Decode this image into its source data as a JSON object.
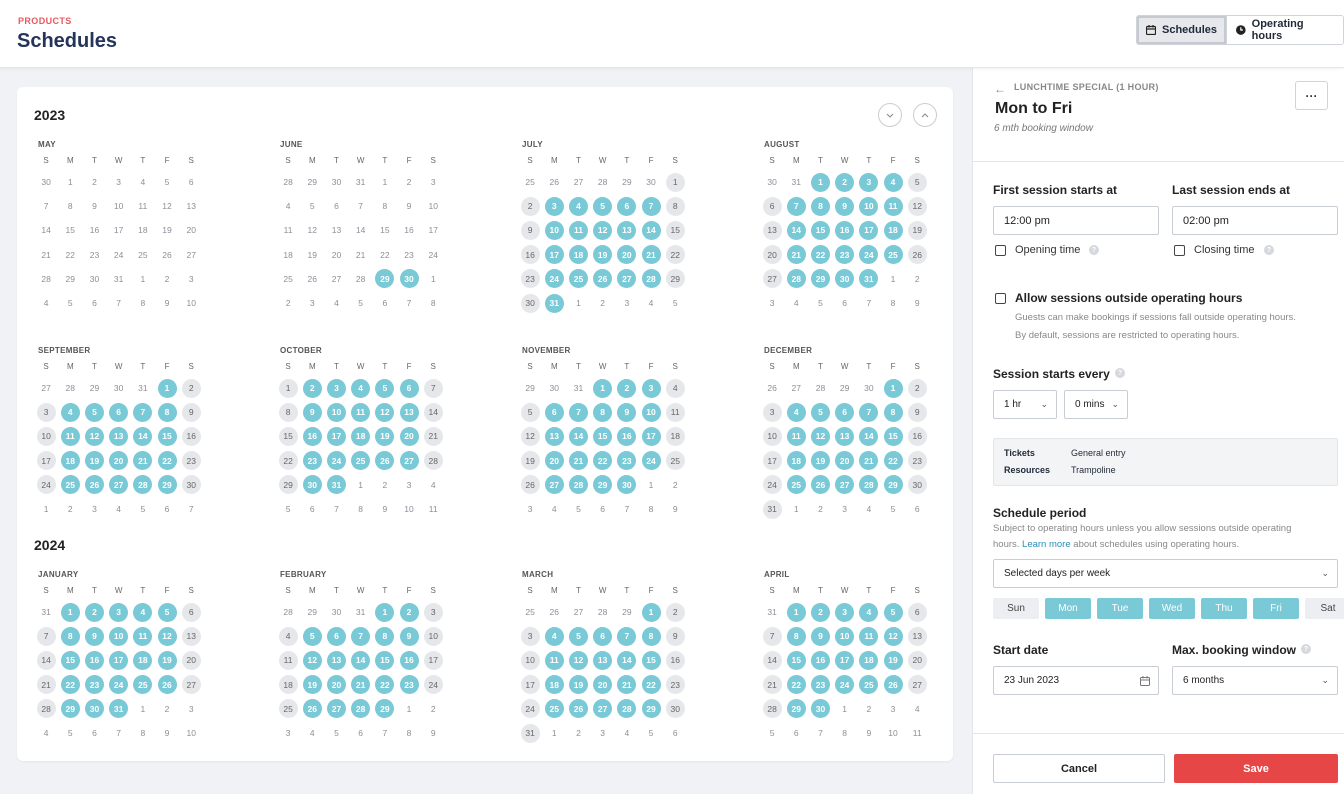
{
  "header": {
    "eyebrow": "PRODUCTS",
    "title": "Schedules",
    "tabs": [
      {
        "label": "Schedules",
        "icon": "calendar-icon",
        "active": true
      },
      {
        "label": "Operating hours",
        "icon": "clock-icon",
        "active": false
      }
    ]
  },
  "calendar": {
    "weekday_labels": [
      "S",
      "M",
      "T",
      "W",
      "T",
      "F",
      "S"
    ],
    "years": [
      {
        "label": "2023",
        "months": [
          {
            "name": "MAY",
            "first": 30,
            "prevLen": 30,
            "len": 31,
            "startDow": 1,
            "blue": [],
            "grey": []
          },
          {
            "name": "JUNE",
            "first": 28,
            "prevLen": 31,
            "len": 30,
            "startDow": 4,
            "blue": [
              29,
              30
            ],
            "grey": []
          },
          {
            "name": "JULY",
            "first": 25,
            "prevLen": 30,
            "len": 31,
            "startDow": 6,
            "blue": [
              3,
              4,
              5,
              6,
              7,
              10,
              11,
              12,
              13,
              14,
              17,
              18,
              19,
              20,
              21,
              24,
              25,
              26,
              27,
              28,
              31
            ],
            "grey": [
              1,
              2,
              8,
              9,
              15,
              16,
              22,
              23,
              29,
              30
            ]
          },
          {
            "name": "AUGUST",
            "first": 30,
            "prevLen": 31,
            "len": 31,
            "startDow": 2,
            "blue": [
              1,
              2,
              3,
              4,
              7,
              8,
              9,
              10,
              11,
              14,
              15,
              16,
              17,
              18,
              21,
              22,
              23,
              24,
              25,
              28,
              29,
              30,
              31
            ],
            "grey": [
              5,
              6,
              12,
              13,
              19,
              20,
              26,
              27
            ]
          },
          {
            "name": "SEPTEMBER",
            "first": 27,
            "prevLen": 31,
            "len": 30,
            "startDow": 5,
            "blue": [
              1,
              4,
              5,
              6,
              7,
              8,
              11,
              12,
              13,
              14,
              15,
              18,
              19,
              20,
              21,
              22,
              25,
              26,
              27,
              28,
              29
            ],
            "grey": [
              2,
              3,
              9,
              10,
              16,
              17,
              23,
              24,
              30
            ]
          },
          {
            "name": "OCTOBER",
            "first": 1,
            "prevLen": 30,
            "len": 31,
            "startDow": 0,
            "blue": [
              2,
              3,
              4,
              5,
              6,
              9,
              10,
              11,
              12,
              13,
              16,
              17,
              18,
              19,
              20,
              23,
              24,
              25,
              26,
              27,
              30,
              31
            ],
            "grey": [
              1,
              7,
              8,
              14,
              15,
              21,
              22,
              28,
              29
            ]
          },
          {
            "name": "NOVEMBER",
            "first": 29,
            "prevLen": 31,
            "len": 30,
            "startDow": 3,
            "blue": [
              1,
              2,
              3,
              6,
              7,
              8,
              9,
              10,
              13,
              14,
              15,
              16,
              17,
              20,
              21,
              22,
              23,
              24,
              27,
              28,
              29,
              30
            ],
            "grey": [
              4,
              5,
              11,
              12,
              18,
              19,
              25,
              26
            ]
          },
          {
            "name": "DECEMBER",
            "first": 26,
            "prevLen": 30,
            "len": 31,
            "startDow": 5,
            "blue": [
              1,
              4,
              5,
              6,
              7,
              8,
              11,
              12,
              13,
              14,
              15,
              18,
              19,
              20,
              21,
              22,
              25,
              26,
              27,
              28,
              29
            ],
            "grey": [
              2,
              3,
              9,
              10,
              16,
              17,
              23,
              24,
              30,
              31
            ]
          }
        ]
      },
      {
        "label": "2024",
        "months": [
          {
            "name": "JANUARY",
            "first": 31,
            "prevLen": 31,
            "len": 31,
            "startDow": 1,
            "blue": [
              1,
              2,
              3,
              4,
              5,
              8,
              9,
              10,
              11,
              12,
              15,
              16,
              17,
              18,
              19,
              22,
              23,
              24,
              25,
              26,
              29,
              30,
              31
            ],
            "grey": [
              6,
              7,
              13,
              14,
              20,
              21,
              27,
              28
            ]
          },
          {
            "name": "FEBRUARY",
            "first": 28,
            "prevLen": 31,
            "len": 29,
            "startDow": 4,
            "blue": [
              1,
              2,
              5,
              6,
              7,
              8,
              9,
              12,
              13,
              14,
              15,
              16,
              19,
              20,
              21,
              22,
              23,
              26,
              27,
              28,
              29
            ],
            "grey": [
              3,
              4,
              10,
              11,
              17,
              18,
              24,
              25
            ]
          },
          {
            "name": "MARCH",
            "first": 25,
            "prevLen": 29,
            "len": 31,
            "startDow": 5,
            "blue": [
              1,
              4,
              5,
              6,
              7,
              8,
              11,
              12,
              13,
              14,
              15,
              18,
              19,
              20,
              21,
              22,
              25,
              26,
              27,
              28,
              29
            ],
            "grey": [
              2,
              3,
              9,
              10,
              16,
              17,
              23,
              24,
              30,
              31
            ]
          },
          {
            "name": "APRIL",
            "first": 31,
            "prevLen": 31,
            "len": 30,
            "startDow": 1,
            "blue": [
              1,
              2,
              3,
              4,
              5,
              8,
              9,
              10,
              11,
              12,
              15,
              16,
              17,
              18,
              19,
              22,
              23,
              24,
              25,
              26,
              29,
              30
            ],
            "grey": [
              6,
              7,
              13,
              14,
              20,
              21,
              27,
              28
            ]
          }
        ]
      }
    ]
  },
  "panel": {
    "breadcrumb": "LUNCHTIME SPECIAL (1 HOUR)",
    "title": "Mon to Fri",
    "subtitle": "6 mth booking window",
    "more_label": "···",
    "first_session_label": "First session starts at",
    "first_session_value": "12:00   pm",
    "last_session_label": "Last session ends at",
    "last_session_value": "02:00   pm",
    "opening_time_label": "Opening time",
    "closing_time_label": "Closing time",
    "allow_outside_label": "Allow sessions outside operating hours",
    "allow_outside_note_1": "Guests can make bookings if sessions fall outside operating hours.",
    "allow_outside_note_2": "By default, sessions are restricted to operating hours.",
    "session_every_label": "Session starts every",
    "session_hr": "1 hr",
    "session_mins": "0 mins",
    "tickets_label": "Tickets",
    "tickets_value": "General entry",
    "resources_label": "Resources",
    "resources_value": "Trampoline",
    "schedule_period_label": "Schedule period",
    "schedule_note_1": "Subject to operating hours unless you allow sessions outside operating",
    "schedule_note_2a": "hours.",
    "schedule_note_link": "Learn more",
    "schedule_note_2b": "about schedules using operating hours.",
    "period_select": "Selected days per week",
    "days": [
      {
        "label": "Sun",
        "on": false
      },
      {
        "label": "Mon",
        "on": true
      },
      {
        "label": "Tue",
        "on": true
      },
      {
        "label": "Wed",
        "on": true
      },
      {
        "label": "Thu",
        "on": true
      },
      {
        "label": "Fri",
        "on": true
      },
      {
        "label": "Sat",
        "on": false
      }
    ],
    "start_date_label": "Start date",
    "start_date_value": "23 Jun 2023",
    "max_window_label": "Max. booking window",
    "max_window_value": "6 months",
    "cancel_label": "Cancel",
    "save_label": "Save"
  }
}
